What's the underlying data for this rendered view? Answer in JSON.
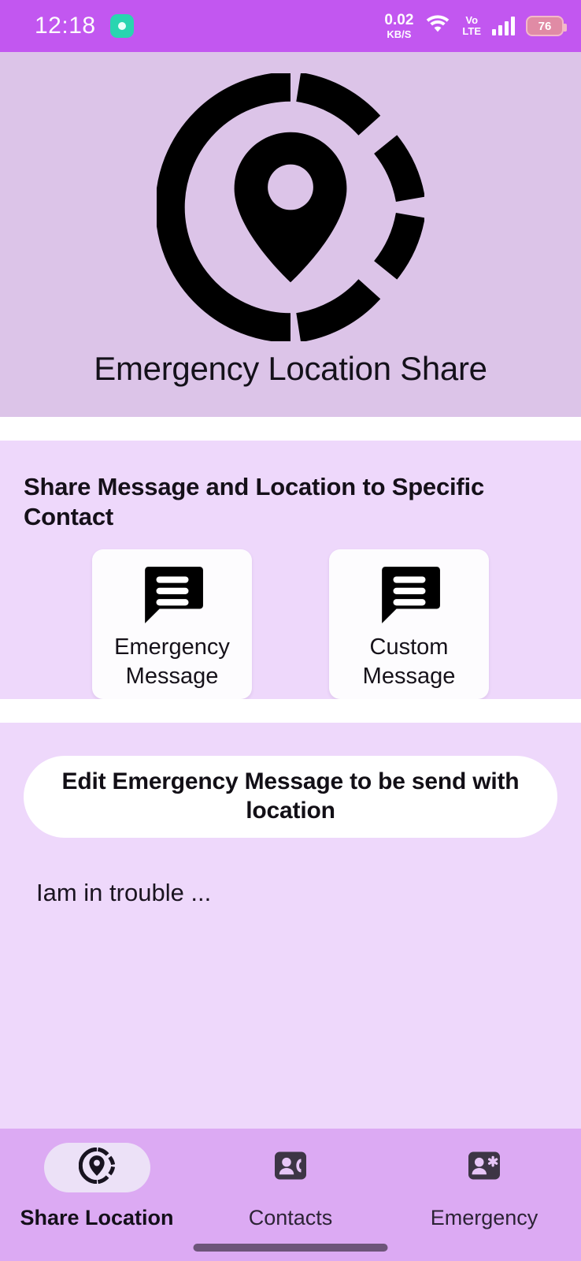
{
  "status_bar": {
    "clock": "12:18",
    "indicator_icon": "record-dot-icon",
    "net_speed_value": "0.02",
    "net_speed_unit": "KB/S",
    "wifi_icon": "wifi-icon",
    "volte_top": "Vo",
    "volte_bottom": "LTE",
    "signal_icon": "signal-bars-icon",
    "battery_level": "76",
    "bg_color": "#c257f0"
  },
  "header": {
    "logo_icon": "location-pin-radar-icon",
    "title": "Emergency Location Share",
    "bg_color": "#dcc4e8"
  },
  "share_section": {
    "title": "Share Message and Location to Specific Contact",
    "bg_color": "#eed8fb",
    "cards": [
      {
        "icon": "chat-bubble-lines-icon",
        "label": "Emergency Message"
      },
      {
        "icon": "chat-bubble-lines-icon",
        "label": "Custom Message"
      }
    ]
  },
  "edit_section": {
    "bg_color": "#eed8fb",
    "edit_button_label": "Edit Emergency Message to be send with location",
    "message_preview": "Iam in trouble ..."
  },
  "bottom_nav": {
    "bg_color": "#dcaaf3",
    "active_index": 0,
    "items": [
      {
        "icon": "location-pin-radar-icon",
        "label": "Share Location"
      },
      {
        "icon": "contact-card-phone-icon",
        "label": "Contacts"
      },
      {
        "icon": "contact-card-star-icon",
        "label": "Emergency"
      }
    ],
    "home_indicator": "home-indicator-bar"
  }
}
